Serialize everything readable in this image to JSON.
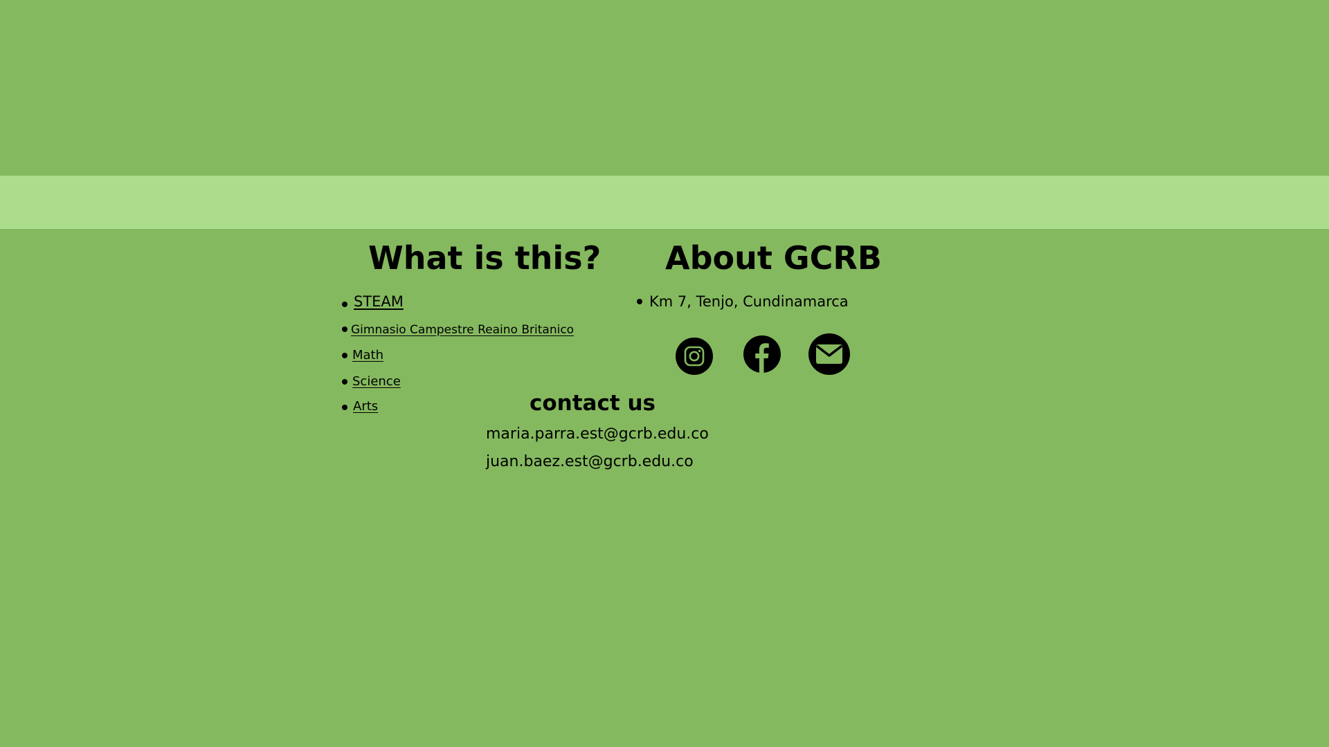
{
  "colors": {
    "background": "#85b95f",
    "band": "#acdd8d",
    "text": "#000000"
  },
  "what_is_this": {
    "title": "What is this?",
    "links": [
      {
        "label": "STEAM"
      },
      {
        "label": "Gimnasio Campestre Reaino Britanico"
      },
      {
        "label": "Math"
      },
      {
        "label": "Science"
      },
      {
        "label": "Arts"
      }
    ]
  },
  "about": {
    "title": "About GCRB",
    "address": "Km 7, Tenjo, Cundinamarca",
    "social_icons": [
      "instagram-icon",
      "facebook-icon",
      "mail-icon"
    ]
  },
  "contact": {
    "title": "contact us",
    "emails": [
      "maria.parra.est@gcrb.edu.co",
      "juan.baez.est@gcrb.edu.co"
    ]
  }
}
